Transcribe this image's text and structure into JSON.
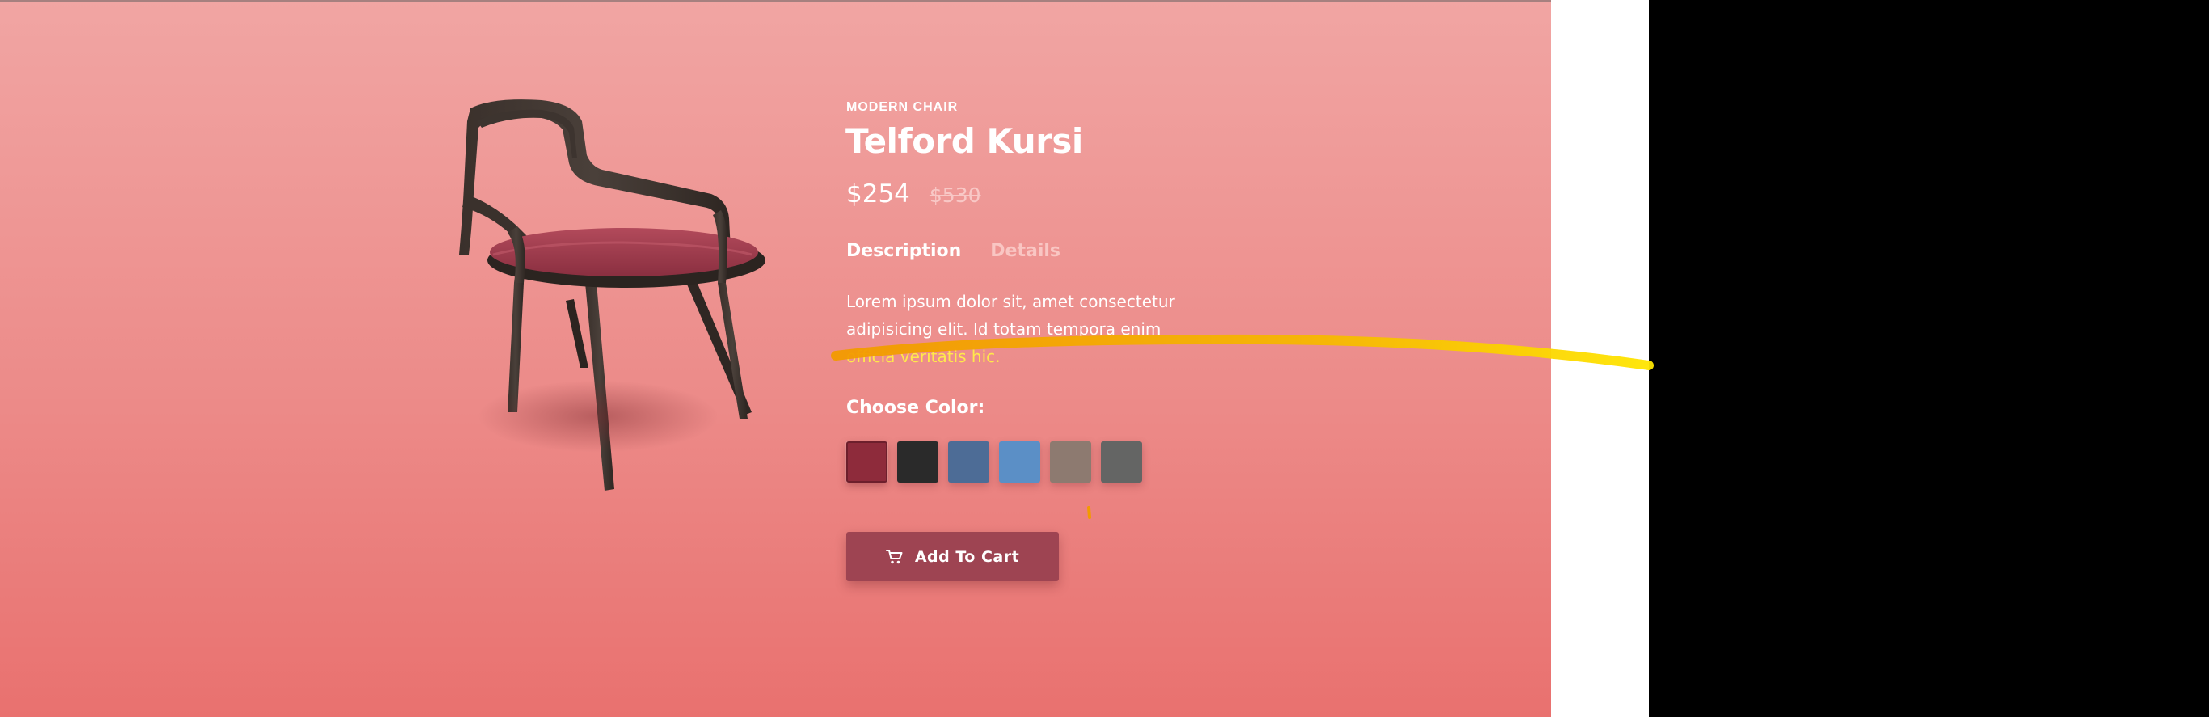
{
  "product": {
    "category": "MODERN CHAIR",
    "title": "Telford Kursi",
    "price": "$254",
    "old_price": "$530"
  },
  "tabs": [
    {
      "label": "Description",
      "active": true
    },
    {
      "label": "Details",
      "active": false
    }
  ],
  "description": {
    "text": "Lorem ipsum dolor sit, amet consectetur adipisicing elit. Id totam tempora enim ",
    "highlighted_text": "officia veritatis hic."
  },
  "color_picker": {
    "heading": "Choose Color:",
    "swatches": [
      {
        "color": "#8e2b3b",
        "selected": true
      },
      {
        "color": "#2a2a2a",
        "selected": false
      },
      {
        "color": "#4d6c96",
        "selected": false
      },
      {
        "color": "#5b8fc6",
        "selected": false
      },
      {
        "color": "#8d7a70",
        "selected": false
      },
      {
        "color": "#646564",
        "selected": false
      }
    ]
  },
  "cart_button": {
    "label": "Add To Cart",
    "icon": "cart-icon"
  },
  "colors": {
    "background_top": "#f1a5a3",
    "background_bottom": "#e9716f",
    "button": "#9e4452",
    "highlight": "#ffe94a"
  }
}
